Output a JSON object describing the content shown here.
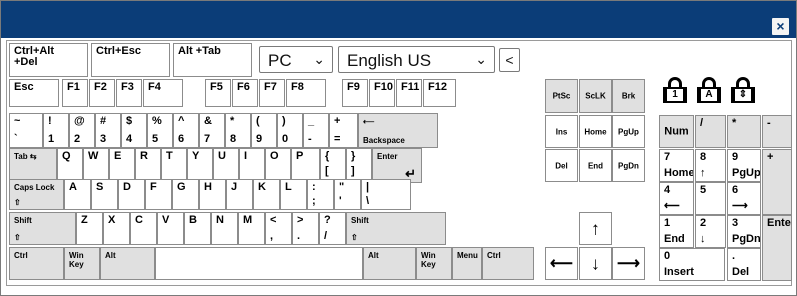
{
  "title": "",
  "close_icon": "×",
  "toolbar": {
    "ctrl_alt_del": "Ctrl+Alt\n+Del",
    "ctrl_esc": "Ctrl+Esc",
    "alt_tab": "Alt +Tab",
    "os_select": "PC",
    "os_arrow": "⌄",
    "lang_select": "English US",
    "lang_arrow": "⌄",
    "collapse": "<"
  },
  "locks": [
    "1",
    "A",
    "⇕"
  ],
  "rows": {
    "fn": [
      {
        "id": "esc",
        "t": "Esc"
      },
      {
        "id": "f1",
        "t": "F1"
      },
      {
        "id": "f2",
        "t": "F2"
      },
      {
        "id": "f3",
        "t": "F3"
      },
      {
        "id": "f4",
        "t": "F4"
      },
      {
        "id": "f5",
        "t": "F5"
      },
      {
        "id": "f6",
        "t": "F6"
      },
      {
        "id": "f7",
        "t": "F7"
      },
      {
        "id": "f8",
        "t": "F8"
      },
      {
        "id": "f9",
        "t": "F9"
      },
      {
        "id": "f10",
        "t": "F10"
      },
      {
        "id": "f11",
        "t": "F11"
      },
      {
        "id": "f12",
        "t": "F12"
      }
    ],
    "num": [
      {
        "id": "tilde",
        "t": "~",
        "b": "`"
      },
      {
        "id": "1",
        "t": "!",
        "b": "1"
      },
      {
        "id": "2",
        "t": "@",
        "b": "2"
      },
      {
        "id": "3",
        "t": "#",
        "b": "3"
      },
      {
        "id": "4",
        "t": "$",
        "b": "4"
      },
      {
        "id": "5",
        "t": "%",
        "b": "5"
      },
      {
        "id": "6",
        "t": "^",
        "b": "6"
      },
      {
        "id": "7",
        "t": "&",
        "b": "7"
      },
      {
        "id": "8",
        "t": "*",
        "b": "8"
      },
      {
        "id": "9",
        "t": "(",
        "b": "9"
      },
      {
        "id": "0",
        "t": ")",
        "b": "0"
      },
      {
        "id": "minus",
        "t": "_",
        "b": "-"
      },
      {
        "id": "equal",
        "t": "+",
        "b": "="
      },
      {
        "id": "backspace",
        "t": "⟵",
        "b": "Backspace"
      }
    ],
    "qwerty": [
      {
        "id": "tab",
        "t": "Tab ⇆"
      },
      {
        "id": "q",
        "t": "Q"
      },
      {
        "id": "w",
        "t": "W"
      },
      {
        "id": "e",
        "t": "E"
      },
      {
        "id": "r",
        "t": "R"
      },
      {
        "id": "t",
        "t": "T"
      },
      {
        "id": "y",
        "t": "Y"
      },
      {
        "id": "u",
        "t": "U"
      },
      {
        "id": "i",
        "t": "I"
      },
      {
        "id": "o",
        "t": "O"
      },
      {
        "id": "p",
        "t": "P"
      },
      {
        "id": "lbrace",
        "t": "{",
        "b": "["
      },
      {
        "id": "rbrace",
        "t": "}",
        "b": "]"
      },
      {
        "id": "enter",
        "t": "Enter",
        "r": "↵"
      }
    ],
    "asdf": [
      {
        "id": "caps",
        "t": "Caps Lock",
        "b": "⇧"
      },
      {
        "id": "a",
        "t": "A"
      },
      {
        "id": "s",
        "t": "S"
      },
      {
        "id": "d",
        "t": "D"
      },
      {
        "id": "f",
        "t": "F"
      },
      {
        "id": "g",
        "t": "G"
      },
      {
        "id": "h",
        "t": "H"
      },
      {
        "id": "j",
        "t": "J"
      },
      {
        "id": "k",
        "t": "K"
      },
      {
        "id": "l",
        "t": "L"
      },
      {
        "id": "semicolon",
        "t": ":",
        "b": ";"
      },
      {
        "id": "quote",
        "t": "\"",
        "b": "'"
      },
      {
        "id": "pipe",
        "t": "|",
        "b": "\\"
      }
    ],
    "zxcv": [
      {
        "id": "lshift",
        "t": "Shift",
        "b": "⇧"
      },
      {
        "id": "z",
        "t": "Z"
      },
      {
        "id": "x",
        "t": "X"
      },
      {
        "id": "c",
        "t": "C"
      },
      {
        "id": "v",
        "t": "V"
      },
      {
        "id": "b",
        "t": "B"
      },
      {
        "id": "n",
        "t": "N"
      },
      {
        "id": "m",
        "t": "M"
      },
      {
        "id": "comma",
        "t": "<",
        "b": ","
      },
      {
        "id": "period",
        "t": ">",
        "b": "."
      },
      {
        "id": "slash",
        "t": "?",
        "b": "/"
      },
      {
        "id": "rshift",
        "t": "Shift",
        "b": "⇧"
      }
    ],
    "bottom": [
      {
        "id": "lctrl",
        "t": "Ctrl"
      },
      {
        "id": "lwin",
        "t": "Win\nKey"
      },
      {
        "id": "lalt",
        "t": "Alt"
      },
      {
        "id": "space",
        "t": ""
      },
      {
        "id": "ralt",
        "t": "Alt"
      },
      {
        "id": "rwin",
        "t": "Win\nKey"
      },
      {
        "id": "menu",
        "t": "Menu"
      },
      {
        "id": "rctrl",
        "t": "Ctrl"
      }
    ]
  },
  "nav": [
    {
      "id": "ptsc",
      "t": "PtSc"
    },
    {
      "id": "sclk",
      "t": "ScLK"
    },
    {
      "id": "brk",
      "t": "Brk"
    },
    {
      "id": "ins",
      "t": "Ins"
    },
    {
      "id": "home",
      "t": "Home"
    },
    {
      "id": "pgup",
      "t": "PgUp"
    },
    {
      "id": "del",
      "t": "Del"
    },
    {
      "id": "end",
      "t": "End"
    },
    {
      "id": "pgdn",
      "t": "PgDn"
    },
    {
      "id": "up",
      "t": "↑"
    },
    {
      "id": "left",
      "t": "⟵"
    },
    {
      "id": "down",
      "t": "↓"
    },
    {
      "id": "right",
      "t": "⟶"
    }
  ],
  "numpad": [
    {
      "id": "num",
      "t": "Num"
    },
    {
      "id": "div",
      "t": "/"
    },
    {
      "id": "mul",
      "t": "*"
    },
    {
      "id": "sub",
      "t": "-"
    },
    {
      "id": "n7",
      "t": "7",
      "b": "Home"
    },
    {
      "id": "n8",
      "t": "8",
      "b": "↑"
    },
    {
      "id": "n9",
      "t": "9",
      "b": "PgUp"
    },
    {
      "id": "add",
      "t": "+"
    },
    {
      "id": "n4",
      "t": "4",
      "b": "⟵"
    },
    {
      "id": "n5",
      "t": "5"
    },
    {
      "id": "n6",
      "t": "6",
      "b": "⟶"
    },
    {
      "id": "n1",
      "t": "1",
      "b": "End"
    },
    {
      "id": "n2",
      "t": "2",
      "b": "↓"
    },
    {
      "id": "n3",
      "t": "3",
      "b": "PgDn"
    },
    {
      "id": "nenter",
      "t": "Enter"
    },
    {
      "id": "n0",
      "t": "0",
      "b": "Insert"
    },
    {
      "id": "ndot",
      "t": ".",
      "b": "Del"
    }
  ]
}
